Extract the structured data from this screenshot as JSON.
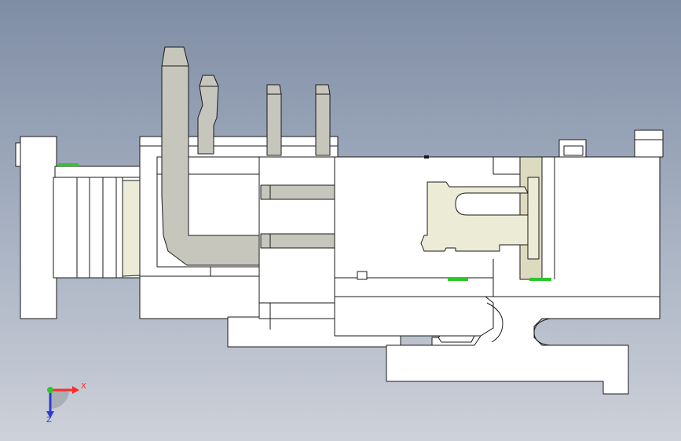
{
  "viewport": {
    "background_top": "#7f8da5",
    "background_bottom": "#cdd1d9",
    "part_fill": "#ffffff",
    "edge_color": "#1a1a1a",
    "pin_fill": "#c7c6bd",
    "latch_fill": "#ecebd5",
    "accent_fill": "#dcdbc0",
    "contact_marker_color": "#2ec52e"
  },
  "triad": {
    "x_label": "X",
    "z_label": "Z",
    "x_color": "#ff2a2a",
    "y_color": "#2ec52e",
    "z_color": "#2b3bd1"
  }
}
